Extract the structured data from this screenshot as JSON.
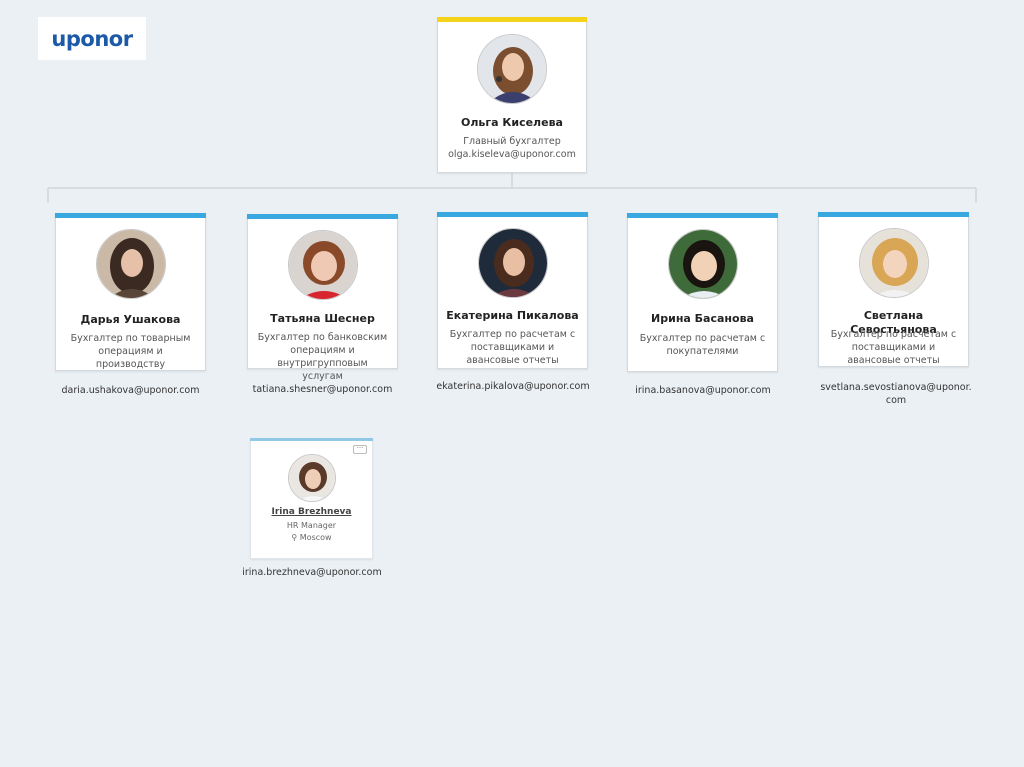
{
  "logo": {
    "text": "uponor"
  },
  "colors": {
    "top_bar": "#f5d31a",
    "member_bar": "#3aa8e0",
    "linkedin_bar": "#8fc9e6",
    "line": "#c4c9ce"
  },
  "head": {
    "name": "Ольга Киселева",
    "role": "Главный бухгалтер",
    "email": "olga.kiseleva@uponor.com"
  },
  "members": [
    {
      "name": "Дарья Ушакова",
      "role": "Бухгалтер по товарным операциям и производству",
      "email": "daria.ushakova@uponor.com"
    },
    {
      "name": "Татьяна Шеснер",
      "role": "Бухгалтер по банковским операциям и внутригрупповым услугам",
      "email": "tatiana.shesner@uponor.com"
    },
    {
      "name": "Екатерина Пикалова",
      "role": "Бухгалтер по расчетам с поставщиками и авансовые отчеты",
      "email": "ekaterina.pikalova@uponor.com"
    },
    {
      "name": "Ирина Басанова",
      "role": "Бухгалтер по расчетам с покупателями",
      "email": "irina.basanova@uponor.com"
    },
    {
      "name": "Светлана Севостьянова",
      "role": "Бухгалтер по расчетам с поставщиками и авансовые отчеты",
      "email": "svetlana.sevostianova@uponor.com"
    }
  ],
  "hr": {
    "name": "Irina Brezhneva",
    "title": "HR Manager",
    "location": "Moscow",
    "more": "···",
    "email": "irina.brezhneva@uponor.com"
  }
}
